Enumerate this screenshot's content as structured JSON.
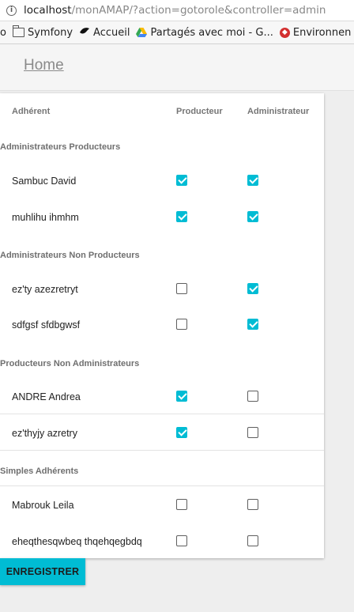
{
  "browser": {
    "url_host": "localhost",
    "url_rest": "/monAMAP/?action=gotorole&controller=admin",
    "bookmarks": [
      "o",
      "Symfony",
      "Accueil",
      "Partagés avec moi - G...",
      "Environnen"
    ]
  },
  "appbar": {
    "home_label": "Home"
  },
  "table": {
    "headers": {
      "member": "Adhérent",
      "producer": "Producteur",
      "admin": "Administrateur"
    },
    "sections": [
      {
        "title": "Administrateurs Producteurs",
        "rows": [
          {
            "name": "Sambuc David",
            "producer": true,
            "admin": true
          },
          {
            "name": "muhlihu ihmhm",
            "producer": true,
            "admin": true
          }
        ]
      },
      {
        "title": "Administrateurs Non Producteurs",
        "rows": [
          {
            "name": "ez'ty azezretryt",
            "producer": false,
            "admin": true
          },
          {
            "name": "sdfgsf sfdbgwsf",
            "producer": false,
            "admin": true
          }
        ]
      },
      {
        "title": "Producteurs Non Administrateurs",
        "rows": [
          {
            "name": "ANDRE Andrea",
            "producer": true,
            "admin": false
          },
          {
            "name": "ez'thyjy azretry",
            "producer": true,
            "admin": false
          }
        ]
      },
      {
        "title": "Simples Adhérents",
        "rows": [
          {
            "name": "Mabrouk Leila",
            "producer": false,
            "admin": false
          },
          {
            "name": "eheqthesqwbeq thqehqegbdq",
            "producer": false,
            "admin": false
          }
        ]
      }
    ]
  },
  "actions": {
    "save_label": "ENREGISTRER"
  },
  "colors": {
    "accent": "#00bcd4"
  }
}
